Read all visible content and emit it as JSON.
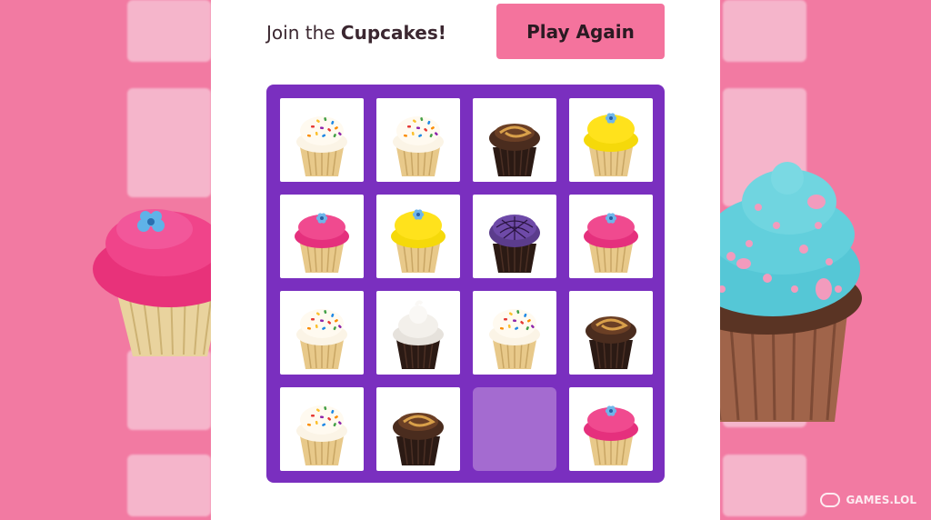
{
  "header": {
    "title_prefix": "Join the ",
    "title_bold": "Cupcakes!",
    "play_again_label": "Play Again"
  },
  "board": {
    "rows": 4,
    "cols": 4,
    "tiles": [
      "vanilla-sprinkles",
      "vanilla-sprinkles",
      "chocolate-swirl",
      "yellow-flower",
      "pink-flower",
      "yellow-flower",
      "purple-web",
      "pink-flower",
      "vanilla-sprinkles",
      "meringue",
      "vanilla-sprinkles",
      "chocolate-swirl",
      "vanilla-sprinkles",
      "chocolate-swirl",
      "empty",
      "pink-flower"
    ]
  },
  "colors": {
    "background": "#f4739d",
    "board": "#7a2fbf",
    "empty_tile": "#a46bd0",
    "button": "#f4739d"
  },
  "decorations": {
    "left_cupcake": "pink-frosted-cupcake",
    "right_cupcake": "blue-frosted-cupcake"
  },
  "watermark": {
    "text": "GAMES.LOL"
  }
}
